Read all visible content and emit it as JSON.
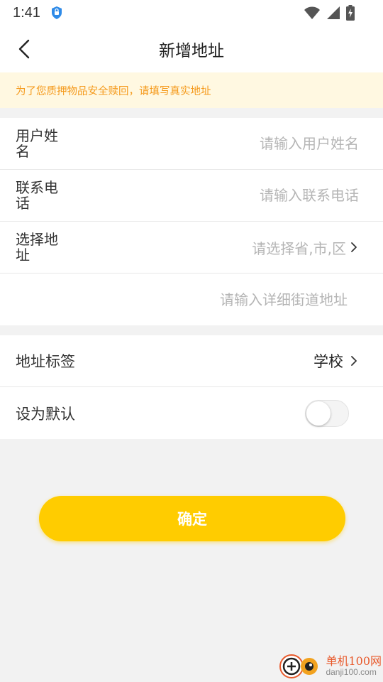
{
  "status_bar": {
    "time": "1:41",
    "icons": [
      "shield-icon",
      "wifi-icon",
      "signal-icon",
      "battery-charging-icon"
    ]
  },
  "navbar": {
    "title": "新增地址",
    "back_icon": "chevron-left-icon"
  },
  "notice": {
    "text": "为了您质押物品安全赎回，请填写真实地址",
    "color": "#f59a1c",
    "background": "#fff8e1"
  },
  "form": {
    "name": {
      "label": "用户姓名",
      "placeholder": "请输入用户姓名"
    },
    "phone": {
      "label": "联系电话",
      "placeholder": "请输入联系电话"
    },
    "region": {
      "label": "选择地址",
      "placeholder": "请选择省,市,区"
    },
    "street": {
      "placeholder": "请输入详细街道地址"
    }
  },
  "settings": {
    "tag": {
      "label": "地址标签",
      "value": "学校"
    },
    "default": {
      "label": "设为默认",
      "enabled": false
    }
  },
  "confirm_button": {
    "label": "确定",
    "color": "#ffcc00"
  },
  "watermark": {
    "name": "单机100网",
    "url": "danji100.com"
  }
}
